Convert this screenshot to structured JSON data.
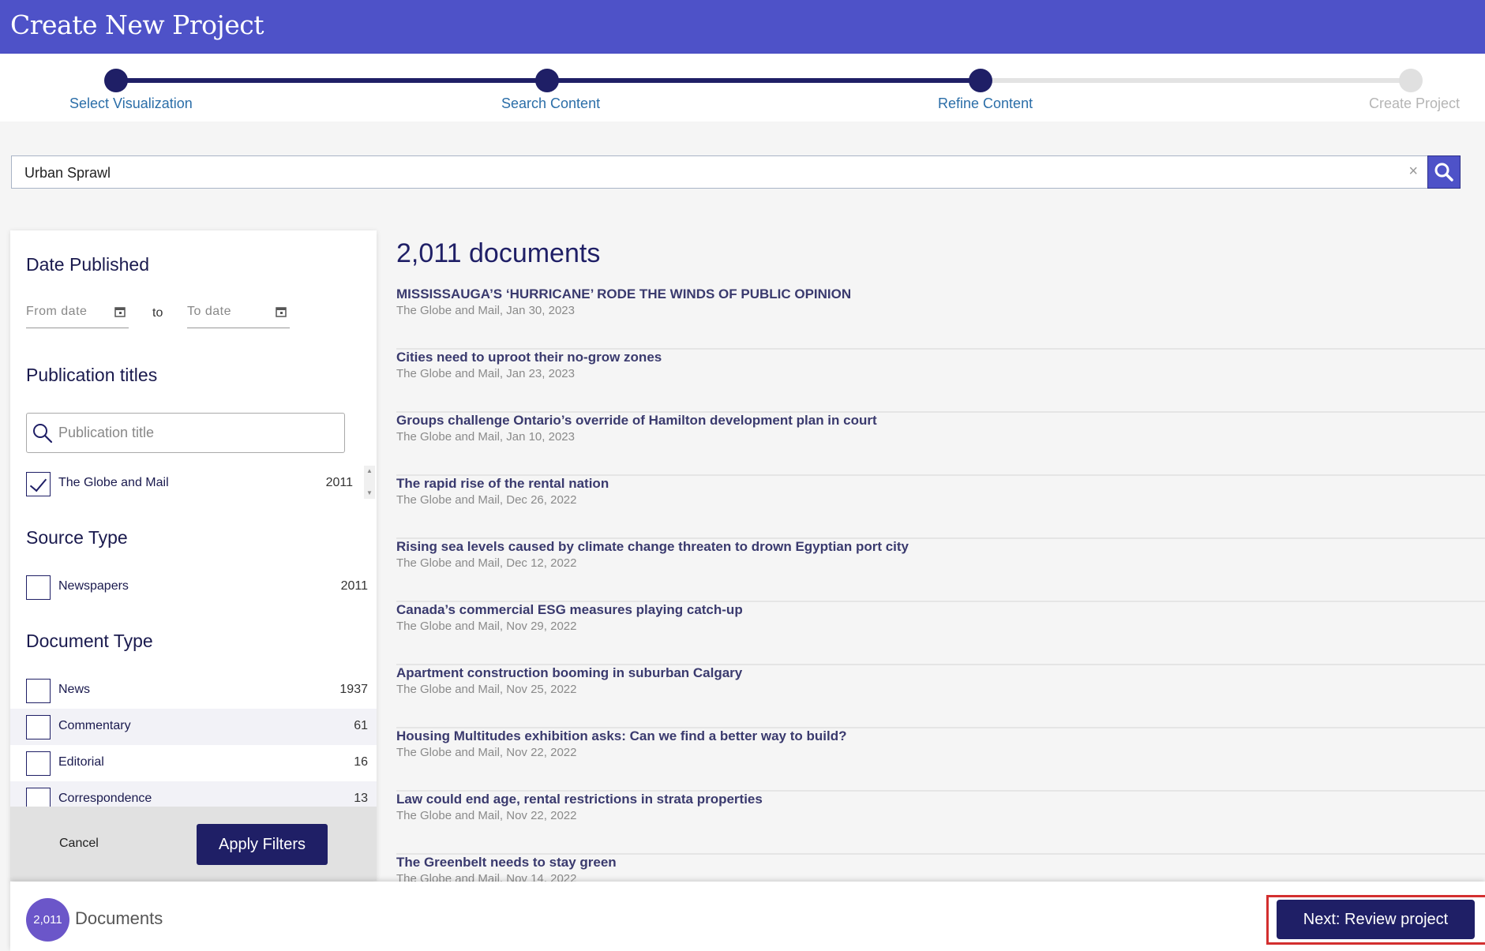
{
  "header": {
    "title": "Create New Project"
  },
  "stepper": {
    "steps": [
      {
        "label": "Select Visualization",
        "status": "done"
      },
      {
        "label": "Search Content",
        "status": "done"
      },
      {
        "label": "Refine Content",
        "status": "current"
      },
      {
        "label": "Create Project",
        "status": "todo"
      }
    ]
  },
  "search": {
    "value": "Urban Sprawl",
    "clear_symbol": "×",
    "icon": "search-icon"
  },
  "filters": {
    "date": {
      "heading": "Date Published",
      "from_placeholder": "From date",
      "to_label": "to",
      "to_placeholder": "To date"
    },
    "publications": {
      "heading": "Publication titles",
      "placeholder": "Publication title",
      "items": [
        {
          "label": "The Globe and Mail",
          "count": "2011",
          "checked": true
        }
      ]
    },
    "source_type": {
      "heading": "Source Type",
      "items": [
        {
          "label": "Newspapers",
          "count": "2011",
          "checked": false
        }
      ]
    },
    "document_type": {
      "heading": "Document Type",
      "items": [
        {
          "label": "News",
          "count": "1937",
          "checked": false
        },
        {
          "label": "Commentary",
          "count": "61",
          "checked": false
        },
        {
          "label": "Editorial",
          "count": "16",
          "checked": false
        },
        {
          "label": "Correspondence",
          "count": "13",
          "checked": false
        }
      ]
    },
    "cancel_label": "Cancel",
    "apply_label": "Apply Filters"
  },
  "results": {
    "count_label": "2,011 documents",
    "items": [
      {
        "title": "MISSISSAUGA’S ‘HURRICANE’ RODE THE WINDS OF PUBLIC OPINION",
        "meta": "The Globe and Mail, Jan 30, 2023"
      },
      {
        "title": "Cities need to uproot their no-grow zones",
        "meta": "The Globe and Mail, Jan 23, 2023"
      },
      {
        "title": "Groups challenge Ontario’s override of Hamilton development plan in court",
        "meta": "The Globe and Mail, Jan 10, 2023"
      },
      {
        "title": "The rapid rise of the rental nation",
        "meta": "The Globe and Mail, Dec 26, 2022"
      },
      {
        "title": "Rising sea levels caused by climate change threaten to drown Egyptian port city",
        "meta": "The Globe and Mail, Dec 12, 2022"
      },
      {
        "title": "Canada’s commercial ESG measures playing catch-up",
        "meta": "The Globe and Mail, Nov 29, 2022"
      },
      {
        "title": "Apartment construction booming in suburban Calgary",
        "meta": "The Globe and Mail, Nov 25, 2022"
      },
      {
        "title": "Housing Multitudes exhibition asks: Can we find a better way to build?",
        "meta": "The Globe and Mail, Nov 22, 2022"
      },
      {
        "title": "Law could end age, rental restrictions in strata properties",
        "meta": "The Globe and Mail, Nov 22, 2022"
      },
      {
        "title": "The Greenbelt needs to stay green",
        "meta": "The Globe and Mail, Nov 14, 2022"
      }
    ]
  },
  "bottom_bar": {
    "count_badge": "2,011",
    "count_label": "Documents",
    "next_label": "Next: Review project"
  },
  "colors": {
    "header": "#4e52c8",
    "primary": "#1f1f66",
    "badge": "#6b56c9",
    "highlight": "#d32f2f"
  }
}
